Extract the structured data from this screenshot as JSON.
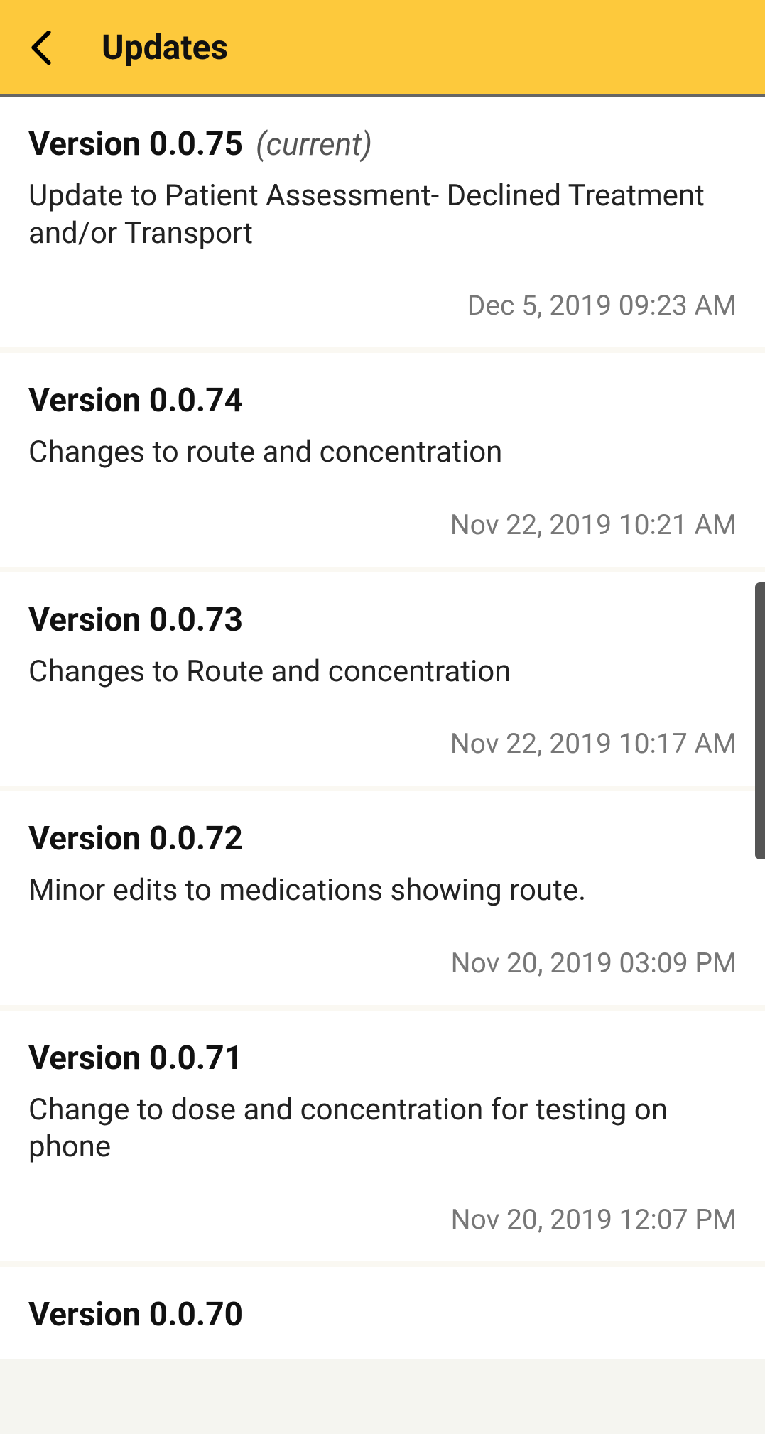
{
  "header": {
    "title": "Updates"
  },
  "current_tag": "(current)",
  "updates": [
    {
      "version": "Version 0.0.75",
      "is_current": true,
      "description": "Update to Patient Assessment- Declined Treatment and/or Transport",
      "timestamp": "Dec 5, 2019 09:23 AM"
    },
    {
      "version": "Version 0.0.74",
      "is_current": false,
      "description": "Changes to route and concentration",
      "timestamp": "Nov 22, 2019 10:21 AM"
    },
    {
      "version": "Version 0.0.73",
      "is_current": false,
      "description": "Changes to Route and concentration",
      "timestamp": "Nov 22, 2019 10:17 AM"
    },
    {
      "version": "Version 0.0.72",
      "is_current": false,
      "description": "Minor edits to medications showing route.",
      "timestamp": "Nov 20, 2019 03:09 PM"
    },
    {
      "version": "Version 0.0.71",
      "is_current": false,
      "description": "Change to dose and concentration for testing on phone",
      "timestamp": "Nov 20, 2019 12:07 PM"
    },
    {
      "version": "Version 0.0.70",
      "is_current": false,
      "description": "",
      "timestamp": ""
    }
  ]
}
